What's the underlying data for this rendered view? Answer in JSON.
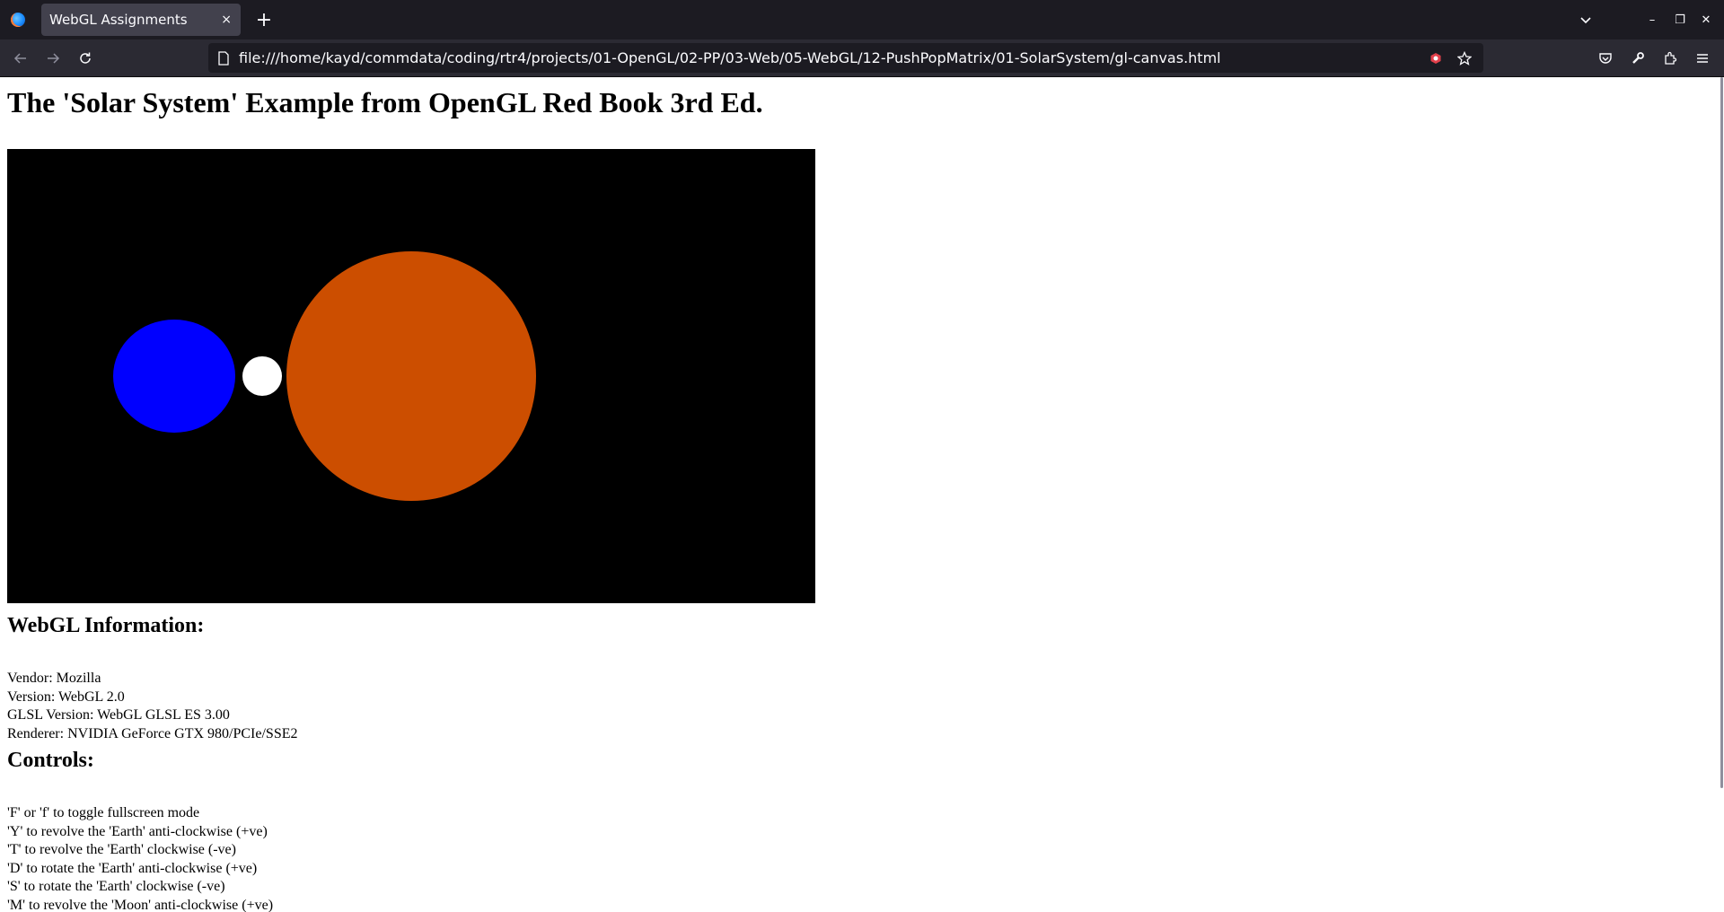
{
  "browser": {
    "tab_title": "WebGL Assignments",
    "tab_close": "×",
    "new_tab": "+",
    "url": "file:///home/kayd/commdata/coding/rtr4/projects/01-OpenGL/02-PP/03-Web/05-WebGL/12-PushPopMatrix/01-SolarSystem/gl-canvas.html",
    "window_controls": {
      "minimize": "–",
      "restore": "❐",
      "close": "✕"
    },
    "icons": [
      "firefox-logo",
      "tab-list-chevron",
      "back-arrow",
      "forward-arrow",
      "reload",
      "page-file-icon",
      "extension-shield",
      "bookmark-star",
      "pocket",
      "wrench",
      "extensions-puzzle",
      "hamburger-menu"
    ]
  },
  "page": {
    "title": "The 'Solar System' Example from OpenGL Red Book 3rd Ed.",
    "canvas": {
      "background": "#000000",
      "bodies": [
        {
          "name": "sun",
          "color": "#cc4e00"
        },
        {
          "name": "earth",
          "color": "#0000ff"
        },
        {
          "name": "moon",
          "color": "#ffffff"
        }
      ]
    },
    "info_heading": "WebGL Information:",
    "info": [
      "Vendor: Mozilla",
      "Version: WebGL 2.0",
      "GLSL Version: WebGL GLSL ES 3.00",
      "Renderer: NVIDIA GeForce GTX 980/PCIe/SSE2"
    ],
    "controls_heading": "Controls:",
    "controls": [
      "'F' or 'f' to toggle fullscreen mode",
      "'Y' to revolve the 'Earth' anti-clockwise (+ve)",
      "'T' to revolve the 'Earth' clockwise (-ve)",
      "'D' to rotate the 'Earth' anti-clockwise (+ve)",
      "'S' to rotate the 'Earth' clockwise (-ve)",
      "'M' to revolve the 'Moon' anti-clockwise (+ve)"
    ]
  }
}
